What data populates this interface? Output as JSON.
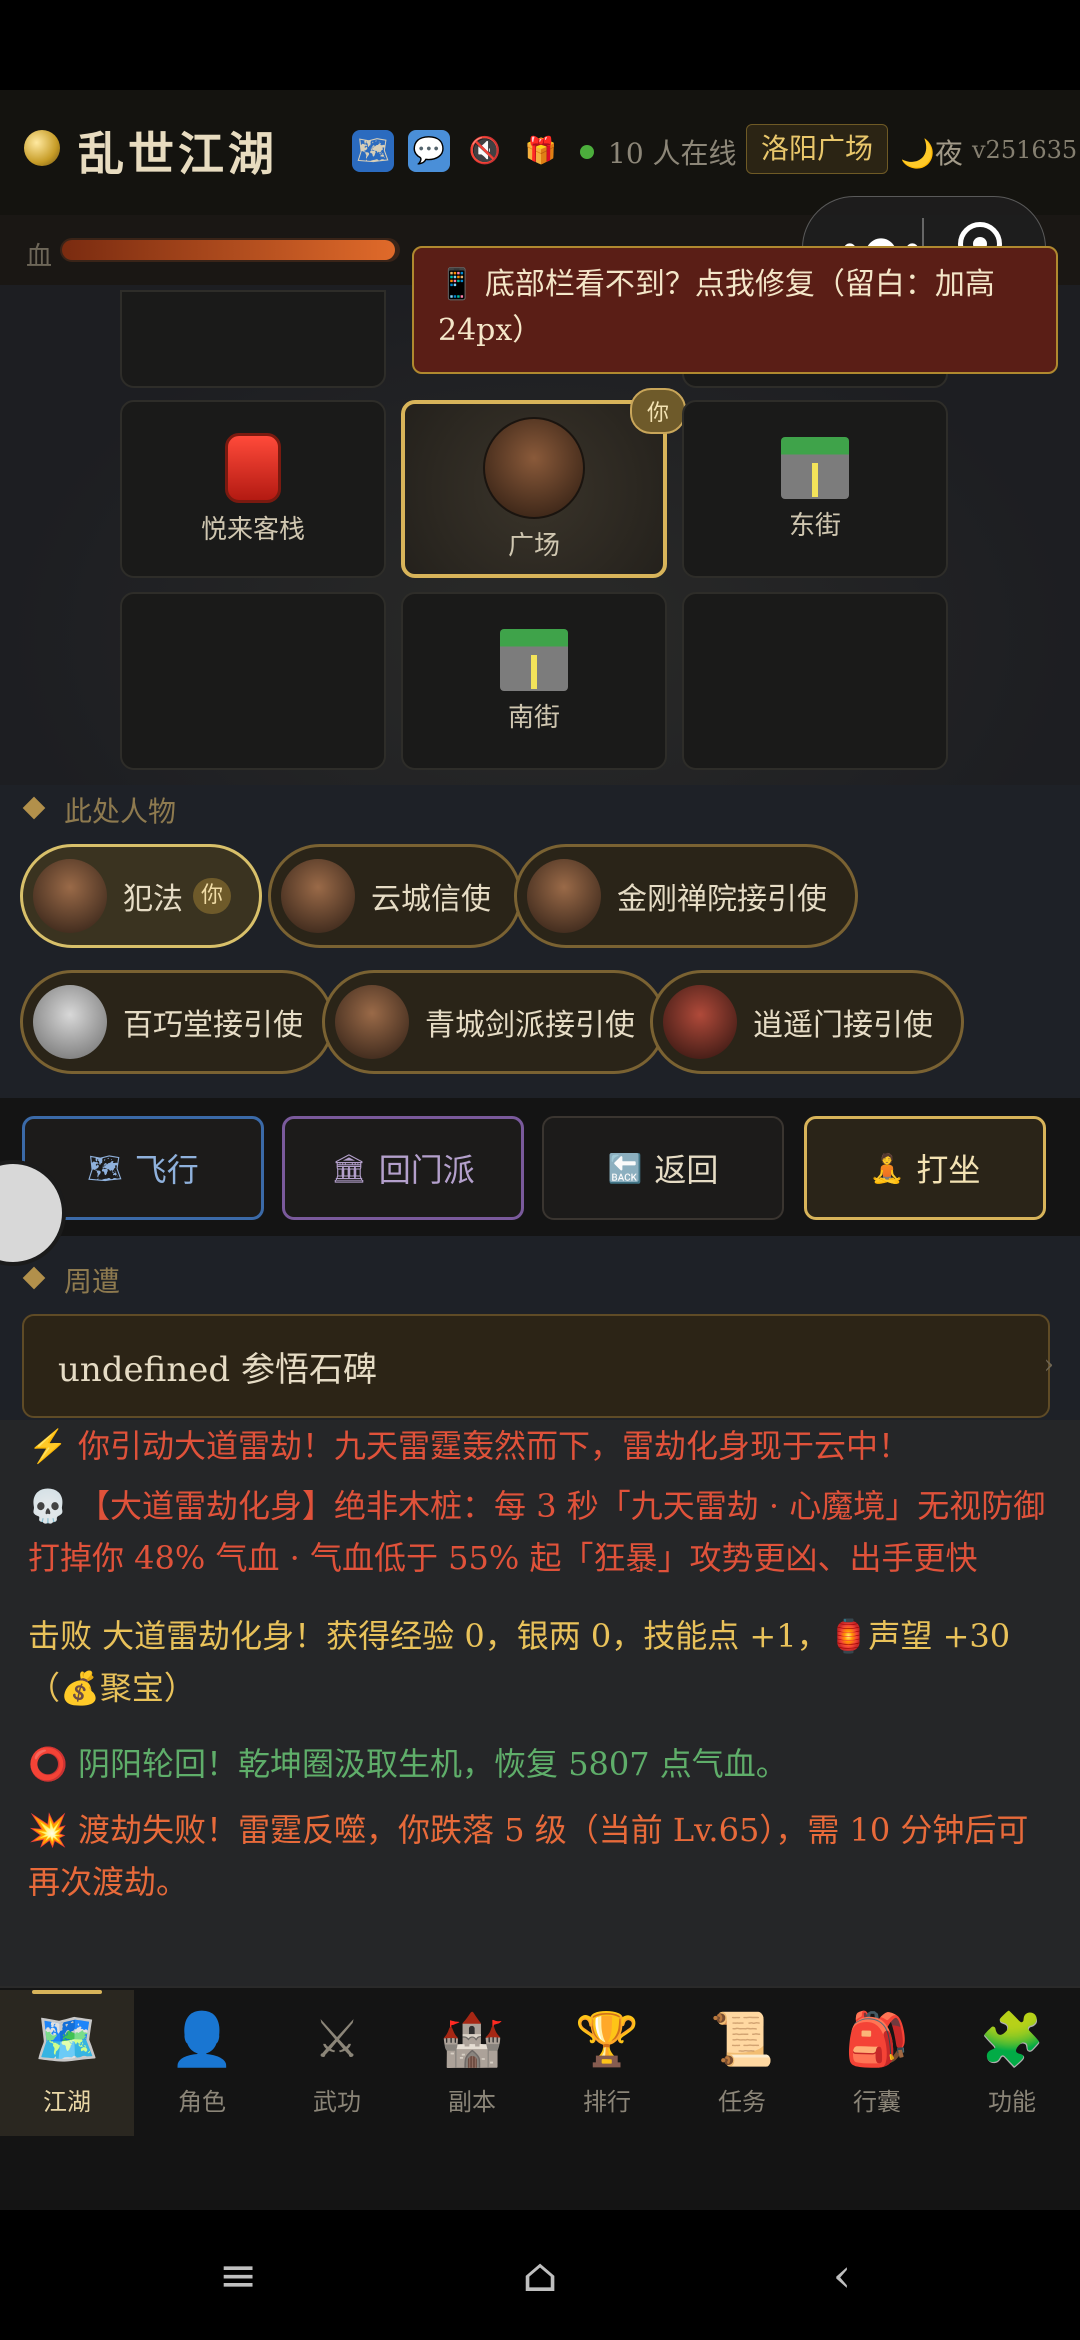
{
  "header": {
    "title": "乱世江湖",
    "online_count": "10",
    "online_suffix": "人在线",
    "location": "洛阳广场",
    "time_of_day": "夜",
    "version": "v251635",
    "icons": [
      "map-icon",
      "chat-icon",
      "mute-icon",
      "gift-icon"
    ]
  },
  "status": {
    "hp_label": "血",
    "hp_fraction": 0.99
  },
  "tip": {
    "text": "📱 底部栏看不到？点我修复（留白：加高24px）"
  },
  "map": {
    "cells": [
      {
        "label": "",
        "icon": "",
        "pos": "r0c0"
      },
      {
        "label": "",
        "icon": "",
        "pos": "r0c2"
      },
      {
        "label": "悦来客栈",
        "icon": "lantern-icon",
        "pos": "r1c0"
      },
      {
        "label": "广场",
        "icon": "player-portrait",
        "pos": "r1c1",
        "current": true
      },
      {
        "label": "东街",
        "icon": "street-icon",
        "pos": "r1c2"
      },
      {
        "label": "",
        "icon": "",
        "pos": "r2c0"
      },
      {
        "label": "南街",
        "icon": "street-icon",
        "pos": "r2c1"
      },
      {
        "label": "",
        "icon": "",
        "pos": "r2c2"
      }
    ],
    "you_tag": "你"
  },
  "people": {
    "title": "此处人物",
    "npcs": [
      {
        "name": "犯法",
        "self": true,
        "tag": "你"
      },
      {
        "name": "云城信使"
      },
      {
        "name": "金刚禅院接引使"
      },
      {
        "name": "百巧堂接引使"
      },
      {
        "name": "青城剑派接引使"
      },
      {
        "name": "逍遥门接引使"
      }
    ]
  },
  "actions": {
    "fly": {
      "label": "飞行",
      "icon": "map-icon"
    },
    "return_sect": {
      "label": "回门派",
      "icon": "temple-icon"
    },
    "back": {
      "label": "返回",
      "icon": "back-icon"
    },
    "meditate": {
      "label": "打坐",
      "icon": "meditate-icon"
    }
  },
  "nearby": {
    "title": "周遭",
    "items": [
      {
        "label": "undefined 参悟石碑"
      }
    ]
  },
  "log": {
    "lines": [
      {
        "icon": "⚡",
        "text": "你引动大道雷劫！九天雷霆轰然而下，雷劫化身现于云中！",
        "color": "#e0523a"
      },
      {
        "icon": "💀",
        "text": "【大道雷劫化身】绝非木桩：每 3 秒「九天雷劫 · 心魔境」无视防御打掉你 48% 气血 · 气血低于 55% 起「狂暴」攻势更凶、出手更快",
        "color": "#e0523a"
      },
      {
        "icon": "",
        "text": "击败 大道雷劫化身！获得经验 0，银两 0，技能点 +1，🏮声望 +30（💰聚宝）",
        "color": "#e9c25a"
      },
      {
        "icon": "⭕",
        "text": "阴阳轮回！乾坤圈汲取生机，恢复 5807 点气血。",
        "color": "#5fae6a"
      },
      {
        "icon": "💥",
        "text": "渡劫失败！雷霆反噬，你跌落 5 级（当前 Lv.65），需 10 分钟后可再次渡劫。",
        "color": "#e86a3a"
      }
    ]
  },
  "bottom_nav": {
    "items": [
      {
        "label": "江湖",
        "icon": "map-icon",
        "glyph": "🗺️",
        "active": true
      },
      {
        "label": "角色",
        "icon": "person-icon",
        "glyph": "👤"
      },
      {
        "label": "武功",
        "icon": "swords-icon",
        "glyph": "⚔"
      },
      {
        "label": "副本",
        "icon": "castle-icon",
        "glyph": "🏰"
      },
      {
        "label": "排行",
        "icon": "trophy-icon",
        "glyph": "🏆"
      },
      {
        "label": "任务",
        "icon": "scroll-icon",
        "glyph": "📜"
      },
      {
        "label": "行囊",
        "icon": "backpack-icon",
        "glyph": "🎒"
      },
      {
        "label": "功能",
        "icon": "puzzle-icon",
        "glyph": "🧩"
      }
    ]
  },
  "system_nav": {
    "icons": [
      "menu-icon",
      "home-icon",
      "back-arrow-icon"
    ]
  }
}
